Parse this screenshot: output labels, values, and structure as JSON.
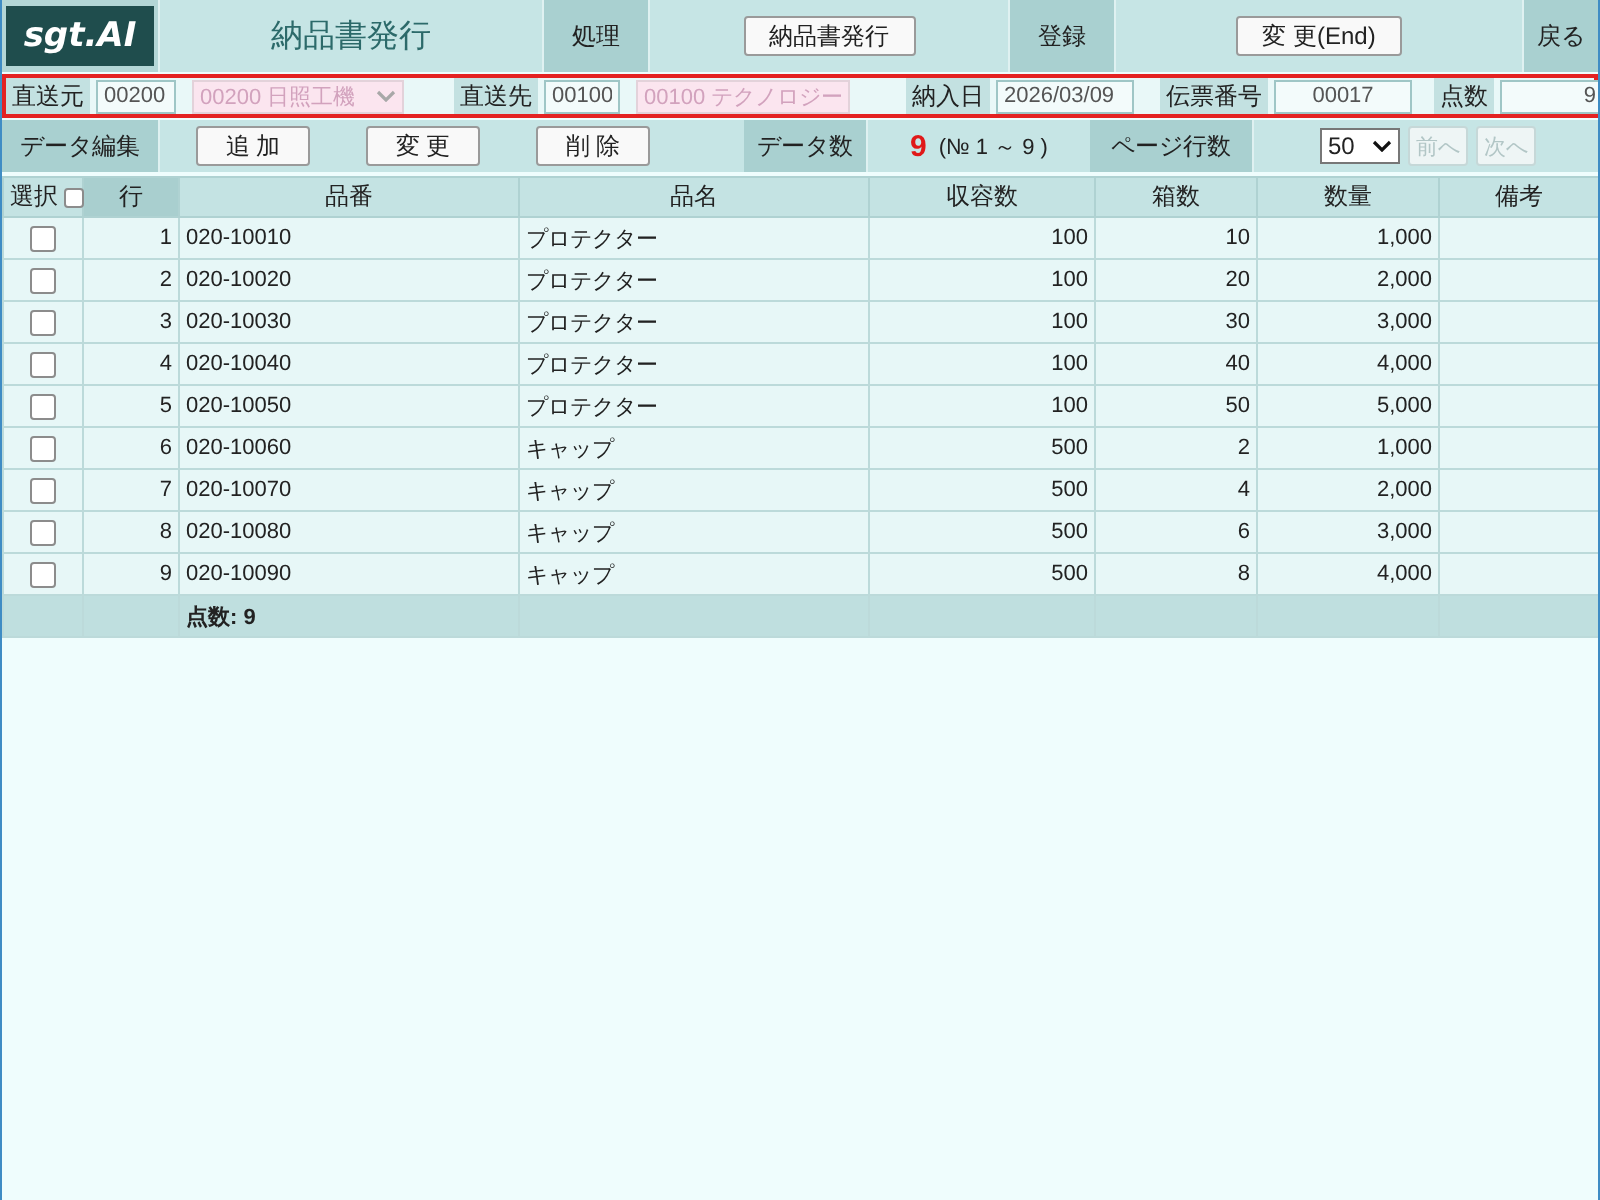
{
  "header": {
    "logo": "sgt.AI",
    "title": "納品書発行",
    "sections": [
      {
        "label": "処理",
        "button": "納品書発行"
      },
      {
        "label": "登録",
        "button": "変 更(End)"
      }
    ],
    "back": "戻る"
  },
  "filter_bar": [
    {
      "label": "直送元",
      "inputs": [
        {
          "kind": "text",
          "value": "00200"
        },
        {
          "kind": "select",
          "value": "00200 日照工機",
          "disabled": true
        }
      ]
    },
    {
      "label": "直送先",
      "inputs": [
        {
          "kind": "text",
          "value": "00100"
        },
        {
          "kind": "select",
          "value": "00100 テクノロジー",
          "disabled": true
        }
      ]
    },
    {
      "label": "納入日",
      "inputs": [
        {
          "kind": "text",
          "value": "2026/03/09"
        }
      ]
    },
    {
      "label": "伝票番号",
      "inputs": [
        {
          "kind": "centered",
          "value": "00017"
        }
      ]
    },
    {
      "label": "点数",
      "inputs": [
        {
          "kind": "number",
          "value": "9"
        }
      ]
    }
  ],
  "toolbar": {
    "edit_label": "データ編集",
    "buttons": [
      "追 加",
      "変 更",
      "削 除"
    ],
    "count_label": "データ数",
    "count": "9",
    "range": "(№ 1 ～ 9 )",
    "page_label": "ページ行数",
    "page_size": "50",
    "pager": [
      {
        "label": "前へ",
        "disabled": true
      },
      {
        "label": "次へ",
        "disabled": true
      }
    ]
  },
  "table": {
    "select_all": {
      "label": "選択",
      "checked": false
    },
    "columns": [
      "行",
      "品番",
      "品名",
      "収容数",
      "箱数",
      "数量",
      "備考"
    ],
    "rows": [
      {
        "checked": false,
        "cells": [
          "1",
          "020-10010",
          "プロテクター",
          "100",
          "10",
          "1,000"
        ]
      },
      {
        "checked": false,
        "cells": [
          "2",
          "020-10020",
          "プロテクター",
          "100",
          "20",
          "2,000"
        ]
      },
      {
        "checked": false,
        "cells": [
          "3",
          "020-10030",
          "プロテクター",
          "100",
          "30",
          "3,000"
        ]
      },
      {
        "checked": false,
        "cells": [
          "4",
          "020-10040",
          "プロテクター",
          "100",
          "40",
          "4,000"
        ]
      },
      {
        "checked": false,
        "cells": [
          "5",
          "020-10050",
          "プロテクター",
          "100",
          "50",
          "5,000"
        ]
      },
      {
        "checked": false,
        "cells": [
          "6",
          "020-10060",
          "キャップ",
          "500",
          "2",
          "1,000"
        ]
      },
      {
        "checked": false,
        "cells": [
          "7",
          "020-10070",
          "キャップ",
          "500",
          "4",
          "2,000"
        ]
      },
      {
        "checked": false,
        "cells": [
          "8",
          "020-10080",
          "キャップ",
          "500",
          "6",
          "3,000"
        ]
      },
      {
        "checked": false,
        "cells": [
          "9",
          "020-10090",
          "キャップ",
          "500",
          "8",
          "4,000"
        ]
      }
    ],
    "footer": "点数: 9"
  }
}
